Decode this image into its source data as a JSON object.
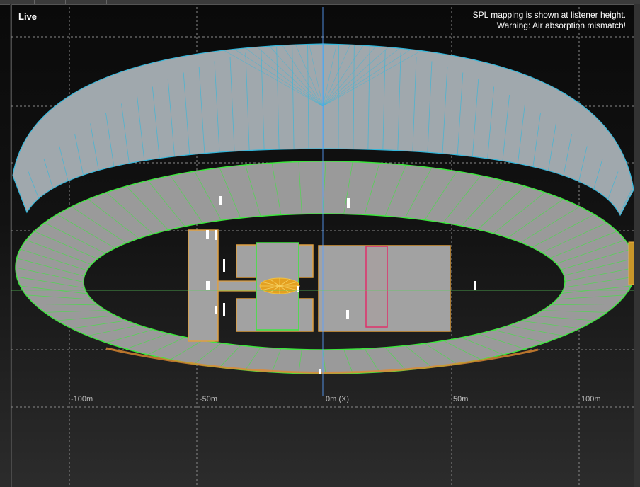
{
  "view": {
    "mode_label": "Live",
    "notices": [
      "SPL mapping is shown at listener height.",
      "Warning: Air absorption mismatch!"
    ]
  },
  "x_axis": {
    "labels": [
      "-100m",
      "-50m",
      "0m (X)",
      "50m",
      "100m"
    ]
  },
  "colors": {
    "background": "#111111",
    "grid": "#8a8a8a",
    "axis_line": "#5aa0ff",
    "upper_tier_lines": "#34b8dc",
    "lower_tier_outline": "#3ee63e",
    "structure_outline": "#e0a040",
    "highlight_outline": "#e0306a",
    "surface": "#9c9c9c"
  }
}
